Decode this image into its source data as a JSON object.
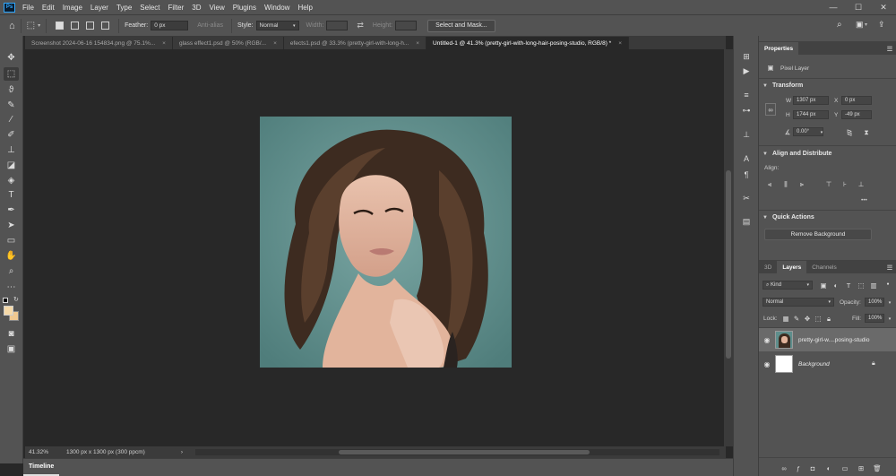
{
  "app": {
    "logo": "Ps"
  },
  "menu": [
    "File",
    "Edit",
    "Image",
    "Layer",
    "Type",
    "Select",
    "Filter",
    "3D",
    "View",
    "Plugins",
    "Window",
    "Help"
  ],
  "window_controls": {
    "minimize": "—",
    "maximize": "☐",
    "close": "✕"
  },
  "options": {
    "feather_label": "Feather:",
    "feather_value": "0 px",
    "antialias_label": "Anti-alias",
    "style_label": "Style:",
    "style_value": "Normal",
    "width_label": "Width:",
    "height_label": "Height:",
    "select_mask_label": "Select and Mask..."
  },
  "tabs": [
    {
      "label": "Screenshot 2024-06-16 154834.png @ 75.1%...",
      "close": "×"
    },
    {
      "label": "glass effect1.psd @ 50% (RGB/...",
      "close": "×"
    },
    {
      "label": "efects1.psd @ 33.3% (pretty-girl-with-long-h...",
      "close": "×"
    },
    {
      "label": "Untitled-1 @ 41.3% (pretty-girl-with-long-hair-posing-studio, RGB/8) *",
      "close": "×"
    }
  ],
  "status": {
    "zoom": "41.32%",
    "doc_info": "1300 px x 1300 px (300 ppcm)",
    "arrow": "›"
  },
  "timeline": {
    "label": "Timeline"
  },
  "properties": {
    "tab_label": "Properties",
    "layer_type": "Pixel Layer",
    "transform": {
      "title": "Transform",
      "w_label": "W",
      "w_value": "1307 px",
      "h_label": "H",
      "h_value": "1744 px",
      "x_label": "X",
      "x_value": "0 px",
      "y_label": "Y",
      "y_value": "-49 px",
      "angle_value": "0.00°"
    },
    "align": {
      "title": "Align and Distribute",
      "label": "Align:",
      "more": "•••"
    },
    "quick_actions": {
      "title": "Quick Actions",
      "remove_bg_label": "Remove Background"
    }
  },
  "layers_panel": {
    "tabs": [
      "3D",
      "Layers",
      "Channels"
    ],
    "kind_label": "Kind",
    "blend_mode": "Normal",
    "opacity_label": "Opacity:",
    "opacity_value": "100%",
    "lock_label": "Lock:",
    "fill_label": "Fill:",
    "fill_value": "100%",
    "layers": [
      {
        "name": "pretty-girl-w....posing-studio",
        "selected": true
      },
      {
        "name": "Background",
        "selected": false
      }
    ]
  },
  "colors": {
    "accent": "#31a8ff",
    "canvas_bg": "#282828",
    "panel_bg": "#535353",
    "artwork_bg": "#5e8e8c",
    "foreground_swatch": "#f5d9a8",
    "background_swatch": "#f0c890"
  }
}
